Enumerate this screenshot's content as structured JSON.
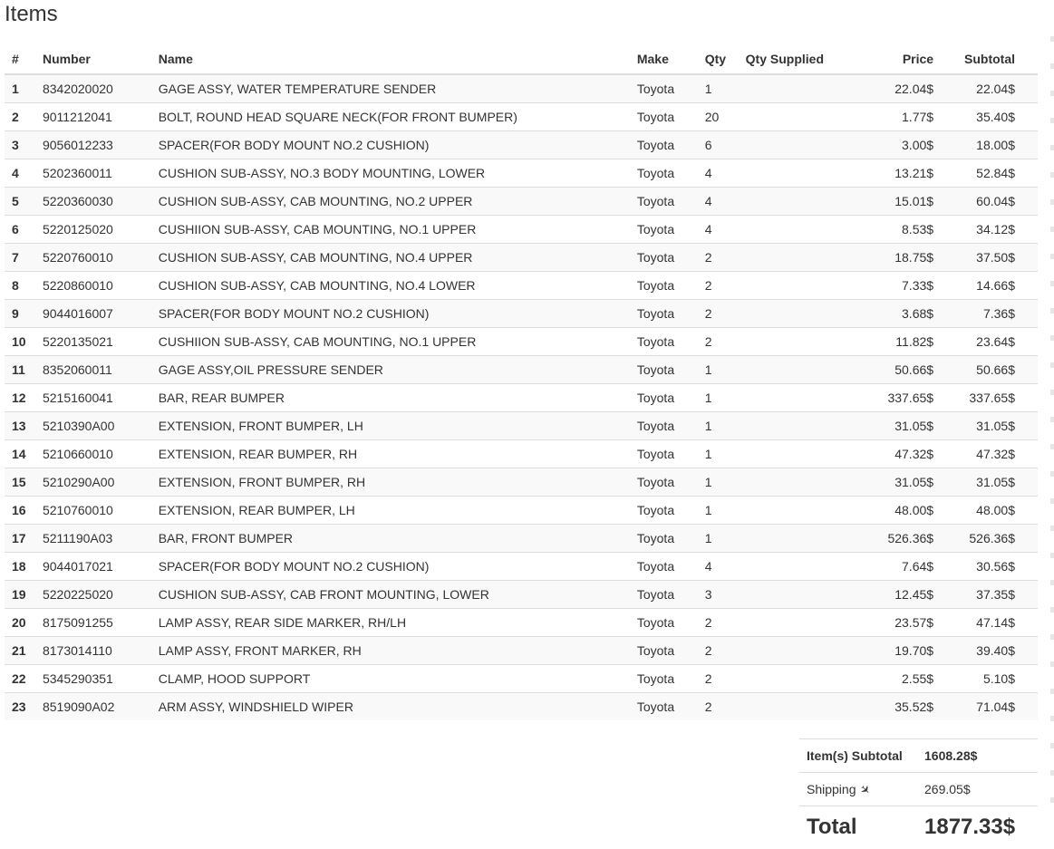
{
  "title": "Items",
  "columns": {
    "idx": "#",
    "number": "Number",
    "name": "Name",
    "make": "Make",
    "qty": "Qty",
    "qty_supplied": "Qty Supplied",
    "price": "Price",
    "subtotal": "Subtotal"
  },
  "items": [
    {
      "idx": "1",
      "number": "8342020020",
      "name": "GAGE ASSY, WATER TEMPERATURE SENDER",
      "make": "Toyota",
      "qty": "1",
      "qty_supplied": "",
      "price": "22.04$",
      "subtotal": "22.04$"
    },
    {
      "idx": "2",
      "number": "9011212041",
      "name": "BOLT, ROUND HEAD SQUARE NECK(FOR FRONT BUMPER)",
      "make": "Toyota",
      "qty": "20",
      "qty_supplied": "",
      "price": "1.77$",
      "subtotal": "35.40$"
    },
    {
      "idx": "3",
      "number": "9056012233",
      "name": "SPACER(FOR BODY MOUNT NO.2 CUSHION)",
      "make": "Toyota",
      "qty": "6",
      "qty_supplied": "",
      "price": "3.00$",
      "subtotal": "18.00$"
    },
    {
      "idx": "4",
      "number": "5202360011",
      "name": "CUSHION SUB-ASSY, NO.3 BODY MOUNTING, LOWER",
      "make": "Toyota",
      "qty": "4",
      "qty_supplied": "",
      "price": "13.21$",
      "subtotal": "52.84$"
    },
    {
      "idx": "5",
      "number": "5220360030",
      "name": "CUSHION SUB-ASSY, CAB MOUNTING, NO.2 UPPER",
      "make": "Toyota",
      "qty": "4",
      "qty_supplied": "",
      "price": "15.01$",
      "subtotal": "60.04$"
    },
    {
      "idx": "6",
      "number": "5220125020",
      "name": "CUSHIION SUB-ASSY, CAB MOUNTING, NO.1 UPPER",
      "make": "Toyota",
      "qty": "4",
      "qty_supplied": "",
      "price": "8.53$",
      "subtotal": "34.12$"
    },
    {
      "idx": "7",
      "number": "5220760010",
      "name": "CUSHION SUB-ASSY, CAB MOUNTING, NO.4 UPPER",
      "make": "Toyota",
      "qty": "2",
      "qty_supplied": "",
      "price": "18.75$",
      "subtotal": "37.50$"
    },
    {
      "idx": "8",
      "number": "5220860010",
      "name": "CUSHION SUB-ASSY, CAB MOUNTING, NO.4 LOWER",
      "make": "Toyota",
      "qty": "2",
      "qty_supplied": "",
      "price": "7.33$",
      "subtotal": "14.66$"
    },
    {
      "idx": "9",
      "number": "9044016007",
      "name": "SPACER(FOR BODY MOUNT NO.2 CUSHION)",
      "make": "Toyota",
      "qty": "2",
      "qty_supplied": "",
      "price": "3.68$",
      "subtotal": "7.36$"
    },
    {
      "idx": "10",
      "number": "5220135021",
      "name": "CUSHIION SUB-ASSY, CAB MOUNTING, NO.1 UPPER",
      "make": "Toyota",
      "qty": "2",
      "qty_supplied": "",
      "price": "11.82$",
      "subtotal": "23.64$"
    },
    {
      "idx": "11",
      "number": "8352060011",
      "name": "GAGE ASSY,OIL PRESSURE SENDER",
      "make": "Toyota",
      "qty": "1",
      "qty_supplied": "",
      "price": "50.66$",
      "subtotal": "50.66$"
    },
    {
      "idx": "12",
      "number": "5215160041",
      "name": "BAR, REAR BUMPER",
      "make": "Toyota",
      "qty": "1",
      "qty_supplied": "",
      "price": "337.65$",
      "subtotal": "337.65$"
    },
    {
      "idx": "13",
      "number": "5210390A00",
      "name": "EXTENSION, FRONT BUMPER, LH",
      "make": "Toyota",
      "qty": "1",
      "qty_supplied": "",
      "price": "31.05$",
      "subtotal": "31.05$"
    },
    {
      "idx": "14",
      "number": "5210660010",
      "name": "EXTENSION, REAR BUMPER, RH",
      "make": "Toyota",
      "qty": "1",
      "qty_supplied": "",
      "price": "47.32$",
      "subtotal": "47.32$"
    },
    {
      "idx": "15",
      "number": "5210290A00",
      "name": "EXTENSION, FRONT BUMPER, RH",
      "make": "Toyota",
      "qty": "1",
      "qty_supplied": "",
      "price": "31.05$",
      "subtotal": "31.05$"
    },
    {
      "idx": "16",
      "number": "5210760010",
      "name": "EXTENSION, REAR BUMPER, LH",
      "make": "Toyota",
      "qty": "1",
      "qty_supplied": "",
      "price": "48.00$",
      "subtotal": "48.00$"
    },
    {
      "idx": "17",
      "number": "5211190A03",
      "name": "BAR, FRONT BUMPER",
      "make": "Toyota",
      "qty": "1",
      "qty_supplied": "",
      "price": "526.36$",
      "subtotal": "526.36$"
    },
    {
      "idx": "18",
      "number": "9044017021",
      "name": "SPACER(FOR BODY MOUNT NO.2 CUSHION)",
      "make": "Toyota",
      "qty": "4",
      "qty_supplied": "",
      "price": "7.64$",
      "subtotal": "30.56$"
    },
    {
      "idx": "19",
      "number": "5220225020",
      "name": "CUSHION SUB-ASSY, CAB FRONT MOUNTING, LOWER",
      "make": "Toyota",
      "qty": "3",
      "qty_supplied": "",
      "price": "12.45$",
      "subtotal": "37.35$"
    },
    {
      "idx": "20",
      "number": "8175091255",
      "name": "LAMP ASSY, REAR SIDE MARKER, RH/LH",
      "make": "Toyota",
      "qty": "2",
      "qty_supplied": "",
      "price": "23.57$",
      "subtotal": "47.14$"
    },
    {
      "idx": "21",
      "number": "8173014110",
      "name": "LAMP ASSY, FRONT MARKER, RH",
      "make": "Toyota",
      "qty": "2",
      "qty_supplied": "",
      "price": "19.70$",
      "subtotal": "39.40$"
    },
    {
      "idx": "22",
      "number": "5345290351",
      "name": "CLAMP, HOOD SUPPORT",
      "make": "Toyota",
      "qty": "2",
      "qty_supplied": "",
      "price": "2.55$",
      "subtotal": "5.10$"
    },
    {
      "idx": "23",
      "number": "8519090A02",
      "name": "ARM ASSY, WINDSHIELD WIPER",
      "make": "Toyota",
      "qty": "2",
      "qty_supplied": "",
      "price": "35.52$",
      "subtotal": "71.04$"
    }
  ],
  "totals": {
    "subtotal_label": "Item(s) Subtotal",
    "subtotal_value": "1608.28$",
    "shipping_label": "Shipping",
    "shipping_icon": "plane-icon",
    "shipping_value": "269.05$",
    "total_label": "Total",
    "total_value": "1877.33$"
  }
}
